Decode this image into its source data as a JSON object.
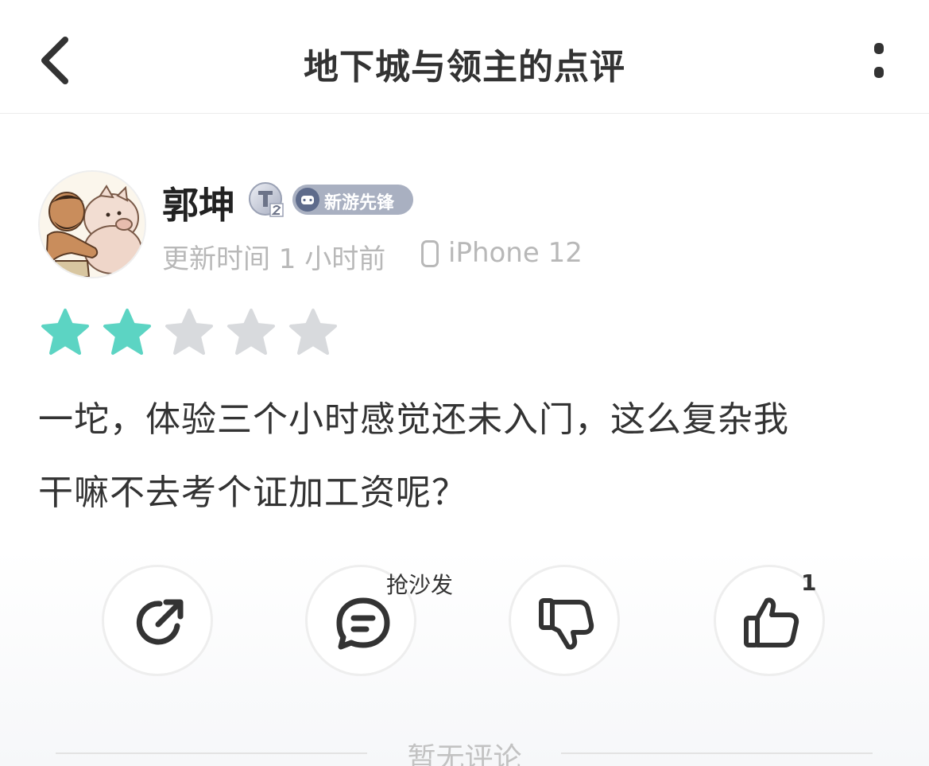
{
  "header": {
    "title": "地下城与领主的点评",
    "back_icon": "chevron-left-icon",
    "more_icon": "more-vertical-icon"
  },
  "author": {
    "name": "郭坤",
    "level_badge": "T2",
    "tag": "新游先锋",
    "tag_icon": "gamepad-icon",
    "update_time": "更新时间 1 小时前",
    "device": "iPhone 12",
    "device_icon": "phone-icon"
  },
  "rating": {
    "value": 2,
    "max": 5,
    "filled_color": "#5cd4c3",
    "empty_color": "#d8dadd"
  },
  "review": {
    "lines": [
      "一坨，体验三个小时感觉还未入门，这么复杂我",
      "干嘛不去考个证加工资呢？"
    ]
  },
  "actions": {
    "share_icon": "share-icon",
    "comment_icon": "comment-icon",
    "comment_label": "抢沙发",
    "dislike_icon": "thumbs-down-icon",
    "like_icon": "thumbs-up-icon",
    "like_count": "1"
  },
  "comments": {
    "empty_text": "暂无评论"
  }
}
